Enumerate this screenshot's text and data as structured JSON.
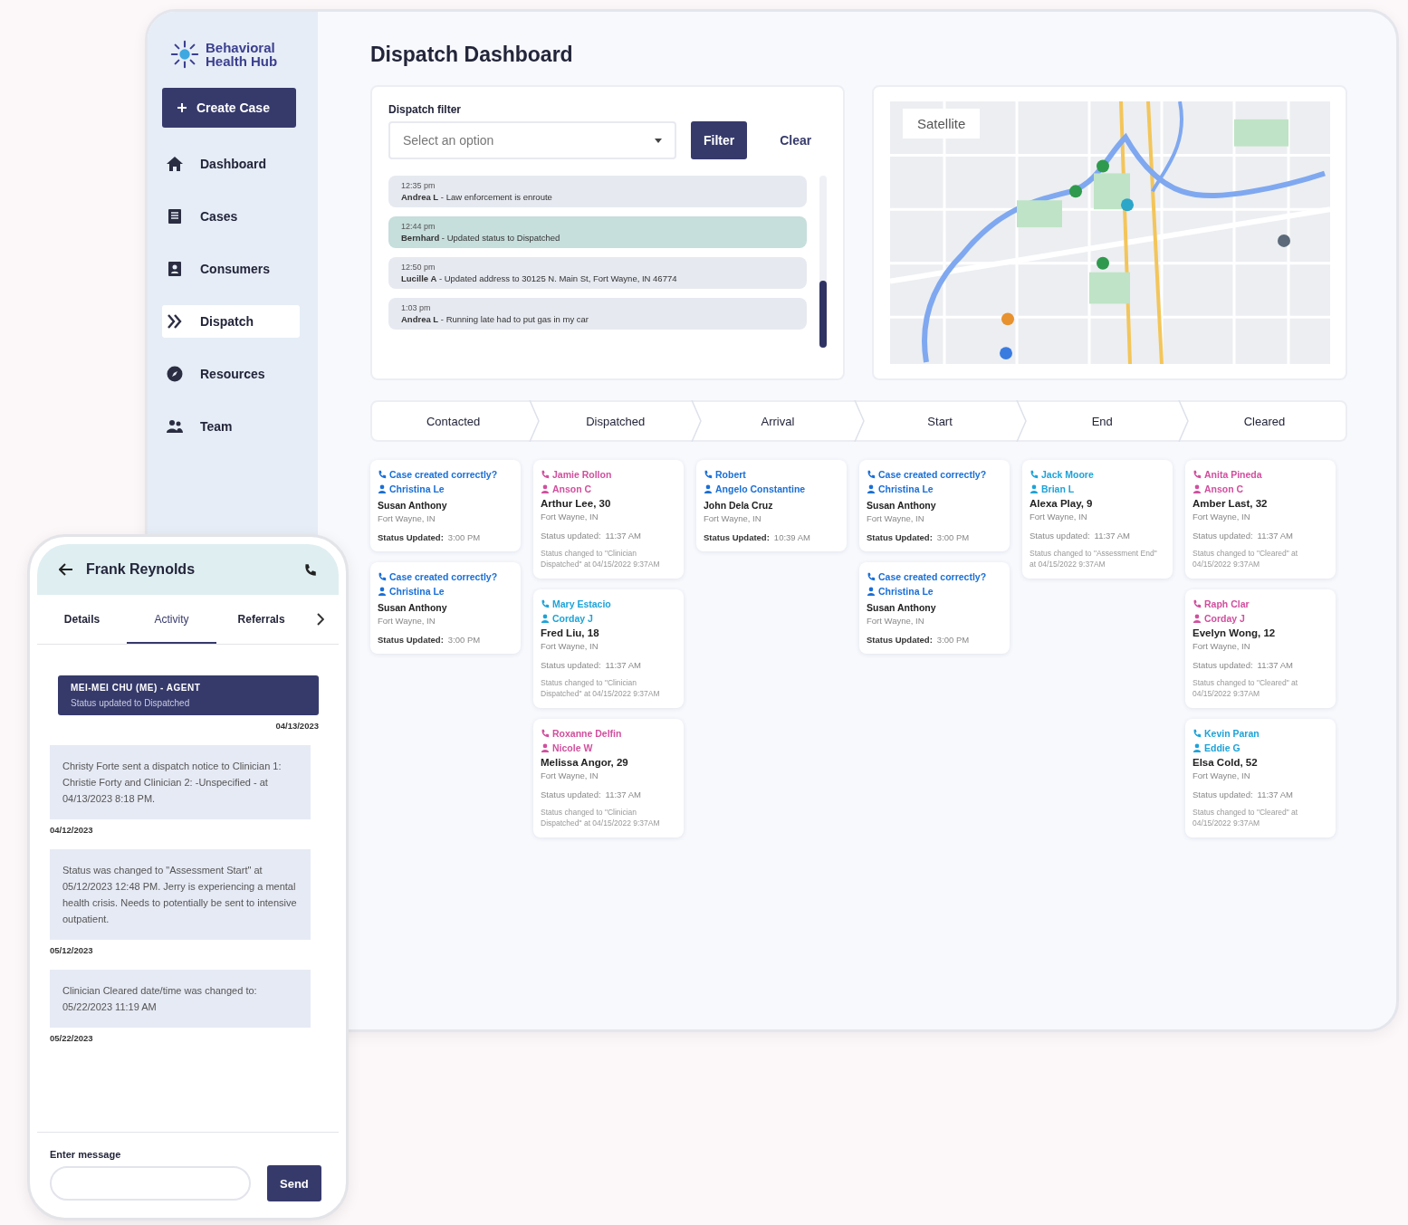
{
  "brand": {
    "name": "Behavioral Health Hub"
  },
  "create_button": {
    "label": "Create Case"
  },
  "nav": [
    {
      "label": "Dashboard",
      "selected": false
    },
    {
      "label": "Cases",
      "selected": false
    },
    {
      "label": "Consumers",
      "selected": false
    },
    {
      "label": "Dispatch",
      "selected": true
    },
    {
      "label": "Resources",
      "selected": false
    },
    {
      "label": "Team",
      "selected": false
    }
  ],
  "page_title": "Dispatch Dashboard",
  "filter": {
    "label": "Dispatch filter",
    "placeholder": "Select an option",
    "filter_button": "Filter",
    "clear_button": "Clear"
  },
  "activity": [
    {
      "time": "12:35 pm",
      "text": "**Andrea L** - Law enforcement is enroute",
      "selected": false
    },
    {
      "time": "12:44 pm",
      "text": "**Bernhard** - Updated status to Dispatched",
      "selected": true
    },
    {
      "time": "12:50 pm",
      "text": "**Lucille A** - Updated address to 30125 N. Main St, Fort Wayne, IN 46774",
      "selected": false
    },
    {
      "time": "1:03 pm",
      "text": "**Andrea L** - Running late had to put gas in my car",
      "selected": false
    }
  ],
  "map": {
    "satellite_button": "Satellite"
  },
  "stages": [
    {
      "label": "Contacted",
      "cards": [
        {
          "kind": "brief",
          "color": "#1a6fd6",
          "caller": "Case created correctly?",
          "assignee": "Christina Le",
          "client": "Susan Anthony",
          "location": "Fort Wayne, IN",
          "status_label": "Status Updated:",
          "status_time": "3:00 PM"
        },
        {
          "kind": "brief",
          "color": "#1a6fd6",
          "caller": "Case created correctly?",
          "assignee": "Christina Le",
          "client": "Susan Anthony",
          "location": "Fort Wayne, IN",
          "status_label": "Status Updated:",
          "status_time": "3:00 PM"
        }
      ]
    },
    {
      "label": "Dispatched",
      "cards": [
        {
          "kind": "detail",
          "color": "#d14f9e",
          "caller": "Jamie Rollon",
          "assignee": "Anson C",
          "client": "Arthur Lee, 30",
          "location": "Fort Wayne, IN",
          "status_label": "Status updated:",
          "status_time": "11:37 AM",
          "note": "Status changed to \"Clinician Dispatched\" at 04/15/2022 9:37AM"
        },
        {
          "kind": "detail",
          "color": "#1ea3d8",
          "caller": "Mary Estacio",
          "assignee": "Corday J",
          "client": "Fred Liu, 18",
          "location": "Fort Wayne, IN",
          "status_label": "Status updated:",
          "status_time": "11:37 AM",
          "note": "Status changed to \"Clinician Dispatched\" at 04/15/2022 9:37AM"
        },
        {
          "kind": "detail",
          "color": "#d14f9e",
          "caller": "Roxanne Delfin",
          "assignee": "Nicole W",
          "client": "Melissa Angor, 29",
          "location": "Fort Wayne, IN",
          "status_label": "Status updated:",
          "status_time": "11:37 AM",
          "note": "Status changed to \"Clinician Dispatched\" at 04/15/2022 9:37AM"
        }
      ]
    },
    {
      "label": "Arrival",
      "cards": [
        {
          "kind": "brief",
          "color": "#1a6fd6",
          "caller": "Robert",
          "assignee": "Angelo Constantine",
          "client": "John Dela Cruz",
          "location": "Fort Wayne, IN",
          "status_label": "Status Updated:",
          "status_time": "10:39 AM"
        }
      ]
    },
    {
      "label": "Start",
      "cards": [
        {
          "kind": "brief",
          "color": "#1a6fd6",
          "caller": "Case created correctly?",
          "assignee": "Christina Le",
          "client": "Susan Anthony",
          "location": "Fort Wayne, IN",
          "status_label": "Status Updated:",
          "status_time": "3:00 PM"
        },
        {
          "kind": "brief",
          "color": "#1a6fd6",
          "caller": "Case created correctly?",
          "assignee": "Christina Le",
          "client": "Susan Anthony",
          "location": "Fort Wayne, IN",
          "status_label": "Status Updated:",
          "status_time": "3:00 PM"
        }
      ]
    },
    {
      "label": "End",
      "cards": [
        {
          "kind": "detail",
          "color": "#1ea3d8",
          "caller": "Jack Moore",
          "assignee": "Brian L",
          "client": "Alexa Play, 9",
          "location": "Fort Wayne, IN",
          "status_label": "Status updated:",
          "status_time": "11:37 AM",
          "note": "Status changed to \"Assessment End\" at 04/15/2022 9:37AM"
        }
      ]
    },
    {
      "label": "Cleared",
      "cards": [
        {
          "kind": "detail",
          "color": "#d14f9e",
          "caller": "Anita Pineda",
          "assignee": "Anson C",
          "client": "Amber Last, 32",
          "location": "Fort Wayne, IN",
          "status_label": "Status updated:",
          "status_time": "11:37 AM",
          "note": "Status changed to \"Cleared\" at 04/15/2022 9:37AM"
        },
        {
          "kind": "detail",
          "color": "#d14f9e",
          "caller": "Raph Clar",
          "assignee": "Corday J",
          "client": "Evelyn Wong, 12",
          "location": "Fort Wayne, IN",
          "status_label": "Status updated:",
          "status_time": "11:37 AM",
          "note": "Status changed to \"Cleared\" at 04/15/2022 9:37AM"
        },
        {
          "kind": "detail",
          "color": "#1ea3d8",
          "caller": "Kevin Paran",
          "assignee": "Eddie G",
          "client": "Elsa Cold, 52",
          "location": "Fort Wayne, IN",
          "status_label": "Status updated:",
          "status_time": "11:37 AM",
          "note": "Status changed to \"Cleared\" at 04/15/2022 9:37AM"
        }
      ]
    }
  ],
  "phone": {
    "contact": "Frank Reynolds",
    "tabs": [
      {
        "label": "Details",
        "selected": false
      },
      {
        "label": "Activity",
        "selected": true
      },
      {
        "label": "Referrals",
        "selected": false
      }
    ],
    "messages": [
      {
        "kind": "agent",
        "author": "MEI-MEI CHU (ME) - AGENT",
        "text": "Status updated to Dispatched",
        "date": "04/13/2023"
      },
      {
        "kind": "note",
        "text": "Christy Forte sent a dispatch notice to Clinician 1: Christie Forty and Clinician 2: -Unspecified - at 04/13/2023 8:18 PM.",
        "date": "04/12/2023"
      },
      {
        "kind": "note",
        "text": "Status was changed to \"Assessment Start\" at 05/12/2023 12:48 PM. Jerry is experiencing a mental health crisis. Needs to potentially be sent to intensive outpatient.",
        "date": "05/12/2023"
      },
      {
        "kind": "note",
        "text": "Clinician Cleared date/time was changed to: 05/22/2023 11:19 AM",
        "date": "05/22/2023"
      }
    ],
    "input_label": "Enter message",
    "send_button": "Send"
  }
}
